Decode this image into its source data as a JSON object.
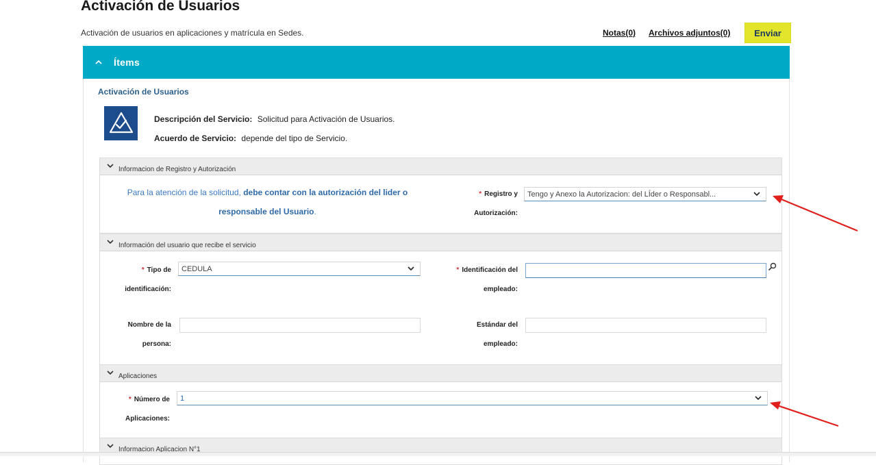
{
  "header": {
    "title": "Activación de Usuarios",
    "subtitle": "Activación de usuarios en aplicaciones y matrícula en Sedes.",
    "notes_link": "Notas(0)",
    "attachments_link": "Archivos adjuntos(0)",
    "send_button": "Enviar"
  },
  "items_bar": {
    "label": "Ítems"
  },
  "service": {
    "title": "Activación de Usuarios",
    "description_label": "Descripción del Servicio:",
    "description_value": "Solicitud  para Activación de Usuarios.",
    "agreement_label": "Acuerdo de Servicio:",
    "agreement_value": "depende del tipo de Servicio."
  },
  "sections": {
    "registro": {
      "title": "Informacion de Registro y Autorización",
      "notice_prefix": "Para la atención de la solicitud,",
      "notice_bold_1": "debe contar con la autorización del lider o",
      "notice_bold_2": "responsable del Usuario",
      "notice_suffix": ".",
      "field_label_1": "Registro y",
      "field_label_2": "Autorización:",
      "field_value": "Tengo y Anexo la Autorizacion: del LÍder o Responsabl..."
    },
    "usuario": {
      "title": "Información del usuario que recibe el servicio",
      "tipo_label_1": "Tipo de",
      "tipo_label_2": "identificación:",
      "tipo_value": "CEDULA",
      "ident_label_1": "Identificación del",
      "ident_label_2": "empleado:",
      "ident_value": "",
      "nombre_label_1": "Nombre de la",
      "nombre_label_2": "persona:",
      "nombre_value": "",
      "estandar_label_1": "Estándar del",
      "estandar_label_2": "empleado:",
      "estandar_value": ""
    },
    "aplicaciones": {
      "title": "Aplicaciones",
      "num_label_1": "Número de",
      "num_label_2": "Aplicaciones:",
      "num_value": "1"
    },
    "aplicacion1": {
      "title": "Informacion Aplicacion N°1"
    }
  },
  "colors": {
    "items_bar": "#00a9c6",
    "send_button": "#e2e52b",
    "required": "#d0343a",
    "annotation_arrow": "#e0201c",
    "logo": "#1d4c8c"
  },
  "icons": {
    "items_toggle": "chevron-up-icon",
    "section_toggle": "chevron-down-icon",
    "select_arrow": "chevron-down-icon",
    "lookup": "search-icon",
    "logo": "check-shield-icon"
  }
}
